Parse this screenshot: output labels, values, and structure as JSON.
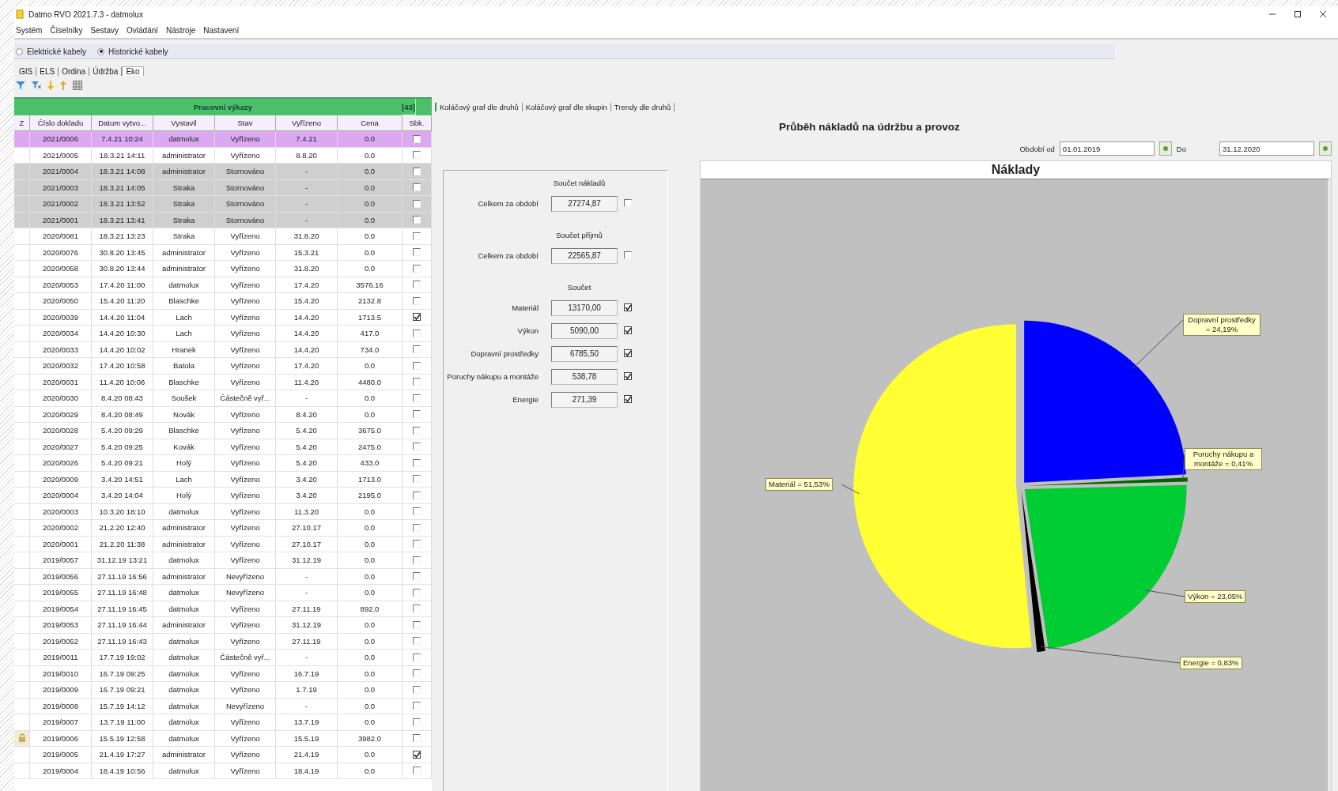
{
  "window": {
    "title": "Datmo RVO 2021.7.3 - datmolux"
  },
  "menu": [
    "Systém",
    "Číselníky",
    "Sestavy",
    "Ovládání",
    "Nástroje",
    "Nastavení"
  ],
  "cable_types": [
    {
      "label": "Elektrické kabely",
      "selected": false
    },
    {
      "label": "Historické kabely",
      "selected": true
    }
  ],
  "modules": [
    {
      "label": "GIS",
      "selected": false
    },
    {
      "label": "ELS",
      "selected": false
    },
    {
      "label": "Ordina",
      "selected": false
    },
    {
      "label": "Údržba",
      "selected": false
    },
    {
      "label": "Eko",
      "selected": true
    }
  ],
  "work_reports": {
    "title": "Pracovní výkazy",
    "count": "[43]",
    "marker_column": "Z",
    "columns": [
      "Číslo dokladu",
      "Datum vytvo...",
      "Vystavil",
      "Stav",
      "Vyřízeno",
      "Cena"
    ],
    "check_column": "Sbk.",
    "rows": [
      {
        "cells": [
          "2021/0006",
          "7.4.21 10:24",
          "datmolux",
          "Vyřízeno",
          "7.4.21",
          "0.0"
        ],
        "selected": true,
        "cancelled": false,
        "locked": false,
        "checked": false
      },
      {
        "cells": [
          "2021/0005",
          "18.3.21 14:11",
          "administrator",
          "Vyřízeno",
          "8.8.20",
          "0.0"
        ],
        "selected": false,
        "cancelled": false,
        "locked": false,
        "checked": false
      },
      {
        "cells": [
          "2021/0004",
          "18.3.21 14:08",
          "administrator",
          "Stornováno",
          "-",
          "0.0"
        ],
        "selected": false,
        "cancelled": true,
        "locked": false,
        "checked": false
      },
      {
        "cells": [
          "2021/0003",
          "18.3.21 14:05",
          "Straka",
          "Stornováno",
          "-",
          "0.0"
        ],
        "selected": false,
        "cancelled": true,
        "locked": false,
        "checked": false
      },
      {
        "cells": [
          "2021/0002",
          "18.3.21 13:52",
          "Straka",
          "Stornováno",
          "-",
          "0.0"
        ],
        "selected": false,
        "cancelled": true,
        "locked": false,
        "checked": false
      },
      {
        "cells": [
          "2021/0001",
          "18.3.21 13:41",
          "Straka",
          "Stornováno",
          "-",
          "0.0"
        ],
        "selected": false,
        "cancelled": true,
        "locked": false,
        "checked": false
      },
      {
        "cells": [
          "2020/0081",
          "18.3.21 13:23",
          "Straka",
          "Vyřízeno",
          "31.8.20",
          "0.0"
        ],
        "selected": false,
        "cancelled": false,
        "locked": false,
        "checked": false
      },
      {
        "cells": [
          "2020/0076",
          "30.8.20 13:45",
          "administrator",
          "Vyřízeno",
          "15.3.21",
          "0.0"
        ],
        "selected": false,
        "cancelled": false,
        "locked": false,
        "checked": false
      },
      {
        "cells": [
          "2020/0058",
          "30.8.20 13:44",
          "administrator",
          "Vyřízeno",
          "31.8.20",
          "0.0"
        ],
        "selected": false,
        "cancelled": false,
        "locked": false,
        "checked": false
      },
      {
        "cells": [
          "2020/0053",
          "17.4.20 11:00",
          "datmolux",
          "Vyřízeno",
          "17.4.20",
          "3576.16"
        ],
        "selected": false,
        "cancelled": false,
        "locked": false,
        "checked": false
      },
      {
        "cells": [
          "2020/0050",
          "15.4.20 11:20",
          "Blaschke",
          "Vyřízeno",
          "15.4.20",
          "2132.8"
        ],
        "selected": false,
        "cancelled": false,
        "locked": false,
        "checked": false
      },
      {
        "cells": [
          "2020/0039",
          "14.4.20 11:04",
          "Lach",
          "Vyřízeno",
          "14.4.20",
          "1713.5"
        ],
        "selected": false,
        "cancelled": false,
        "locked": false,
        "checked": true
      },
      {
        "cells": [
          "2020/0034",
          "14.4.20 10:30",
          "Lach",
          "Vyřízeno",
          "14.4.20",
          "417.0"
        ],
        "selected": false,
        "cancelled": false,
        "locked": false,
        "checked": false
      },
      {
        "cells": [
          "2020/0033",
          "14.4.20 10:02",
          "Hranek",
          "Vyřízeno",
          "14.4.20",
          "734.0"
        ],
        "selected": false,
        "cancelled": false,
        "locked": false,
        "checked": false
      },
      {
        "cells": [
          "2020/0032",
          "17.4.20 10:58",
          "Batola",
          "Vyřízeno",
          "17.4.20",
          "0.0"
        ],
        "selected": false,
        "cancelled": false,
        "locked": false,
        "checked": false
      },
      {
        "cells": [
          "2020/0031",
          "11.4.20 10:06",
          "Blaschke",
          "Vyřízeno",
          "11.4.20",
          "4480.0"
        ],
        "selected": false,
        "cancelled": false,
        "locked": false,
        "checked": false
      },
      {
        "cells": [
          "2020/0030",
          "8.4.20 08:43",
          "Soušek",
          "Částečně vyř...",
          "-",
          "0.0"
        ],
        "selected": false,
        "cancelled": false,
        "locked": false,
        "checked": false
      },
      {
        "cells": [
          "2020/0029",
          "8.4.20 08:49",
          "Novák",
          "Vyřízeno",
          "8.4.20",
          "0.0"
        ],
        "selected": false,
        "cancelled": false,
        "locked": false,
        "checked": false
      },
      {
        "cells": [
          "2020/0028",
          "5.4.20 09:29",
          "Blaschke",
          "Vyřízeno",
          "5.4.20",
          "3675.0"
        ],
        "selected": false,
        "cancelled": false,
        "locked": false,
        "checked": false
      },
      {
        "cells": [
          "2020/0027",
          "5.4.20 09:25",
          "Kovák",
          "Vyřízeno",
          "5.4.20",
          "2475.0"
        ],
        "selected": false,
        "cancelled": false,
        "locked": false,
        "checked": false
      },
      {
        "cells": [
          "2020/0026",
          "5.4.20 09:21",
          "Holý",
          "Vyřízeno",
          "5.4.20",
          "433.0"
        ],
        "selected": false,
        "cancelled": false,
        "locked": false,
        "checked": false
      },
      {
        "cells": [
          "2020/0009",
          "3.4.20 14:51",
          "Lach",
          "Vyřízeno",
          "3.4.20",
          "1713.0"
        ],
        "selected": false,
        "cancelled": false,
        "locked": false,
        "checked": false
      },
      {
        "cells": [
          "2020/0004",
          "3.4.20 14:04",
          "Holý",
          "Vyřízeno",
          "3.4.20",
          "2195.0"
        ],
        "selected": false,
        "cancelled": false,
        "locked": false,
        "checked": false
      },
      {
        "cells": [
          "2020/0003",
          "10.3.20 18:10",
          "datmolux",
          "Vyřízeno",
          "11.3.20",
          "0.0"
        ],
        "selected": false,
        "cancelled": false,
        "locked": false,
        "checked": false
      },
      {
        "cells": [
          "2020/0002",
          "21.2.20 12:40",
          "administrator",
          "Vyřízeno",
          "27.10.17",
          "0.0"
        ],
        "selected": false,
        "cancelled": false,
        "locked": false,
        "checked": false
      },
      {
        "cells": [
          "2020/0001",
          "21.2.20 11:38",
          "administrator",
          "Vyřízeno",
          "27.10.17",
          "0.0"
        ],
        "selected": false,
        "cancelled": false,
        "locked": false,
        "checked": false
      },
      {
        "cells": [
          "2019/0057",
          "31.12.19 13:21",
          "datmolux",
          "Vyřízeno",
          "31.12.19",
          "0.0"
        ],
        "selected": false,
        "cancelled": false,
        "locked": false,
        "checked": false
      },
      {
        "cells": [
          "2019/0056",
          "27.11.19 16:56",
          "administrator",
          "Nevyřízeno",
          "-",
          "0.0"
        ],
        "selected": false,
        "cancelled": false,
        "locked": false,
        "checked": false
      },
      {
        "cells": [
          "2019/0055",
          "27.11.19 16:48",
          "datmolux",
          "Nevyřízeno",
          "-",
          "0.0"
        ],
        "selected": false,
        "cancelled": false,
        "locked": false,
        "checked": false
      },
      {
        "cells": [
          "2019/0054",
          "27.11.19 16:45",
          "datmolux",
          "Vyřízeno",
          "27.11.19",
          "892.0"
        ],
        "selected": false,
        "cancelled": false,
        "locked": false,
        "checked": false
      },
      {
        "cells": [
          "2019/0053",
          "27.11.19 16:44",
          "administrator",
          "Vyřízeno",
          "31.12.19",
          "0.0"
        ],
        "selected": false,
        "cancelled": false,
        "locked": false,
        "checked": false
      },
      {
        "cells": [
          "2019/0052",
          "27.11.19 16:43",
          "datmolux",
          "Vyřízeno",
          "27.11.19",
          "0.0"
        ],
        "selected": false,
        "cancelled": false,
        "locked": false,
        "checked": false
      },
      {
        "cells": [
          "2019/0011",
          "17.7.19 19:02",
          "datmolux",
          "Částečně vyř...",
          "-",
          "0.0"
        ],
        "selected": false,
        "cancelled": false,
        "locked": false,
        "checked": false
      },
      {
        "cells": [
          "2019/0010",
          "16.7.19 09:25",
          "datmolux",
          "Vyřízeno",
          "16.7.19",
          "0.0"
        ],
        "selected": false,
        "cancelled": false,
        "locked": false,
        "checked": false
      },
      {
        "cells": [
          "2019/0009",
          "16.7.19 09:21",
          "datmolux",
          "Vyřízeno",
          "1.7.19",
          "0.0"
        ],
        "selected": false,
        "cancelled": false,
        "locked": false,
        "checked": false
      },
      {
        "cells": [
          "2019/0008",
          "15.7.19 14:12",
          "datmolux",
          "Nevyřízeno",
          "-",
          "0.0"
        ],
        "selected": false,
        "cancelled": false,
        "locked": false,
        "checked": false
      },
      {
        "cells": [
          "2019/0007",
          "13.7.19 11:00",
          "datmolux",
          "Vyřízeno",
          "13.7.19",
          "0.0"
        ],
        "selected": false,
        "cancelled": false,
        "locked": false,
        "checked": false
      },
      {
        "cells": [
          "2019/0006",
          "15.5.19 12:58",
          "datmolux",
          "Vyřízeno",
          "15.5.19",
          "3982.0"
        ],
        "selected": false,
        "cancelled": false,
        "locked": true,
        "checked": false
      },
      {
        "cells": [
          "2019/0005",
          "21.4.19 17:27",
          "administrator",
          "Vyřízeno",
          "21.4.19",
          "0.0"
        ],
        "selected": false,
        "cancelled": false,
        "locked": false,
        "checked": true
      },
      {
        "cells": [
          "2019/0004",
          "18.4.19 10:56",
          "datmolux",
          "Vyřízeno",
          "18.4.19",
          "0.0"
        ],
        "selected": false,
        "cancelled": false,
        "locked": false,
        "checked": false
      }
    ]
  },
  "chart_tabs": [
    {
      "label": "Koláčový graf dle druhů",
      "selected": true
    },
    {
      "label": "Koláčový graf dle skupin",
      "selected": false
    },
    {
      "label": "Trendy dle druhů",
      "selected": false
    }
  ],
  "summary": {
    "groups": [
      {
        "heading": "Součet nákladů",
        "rows": [
          {
            "label": "Celkem za období",
            "value": "27274,87",
            "checked": false
          }
        ]
      },
      {
        "heading": "Součet příjmů",
        "rows": [
          {
            "label": "Celkem za období",
            "value": "22565,87",
            "checked": false
          }
        ]
      },
      {
        "heading": "Součet",
        "rows": [
          {
            "label": "Materiál",
            "value": "13170,00",
            "checked": true
          },
          {
            "label": "Výkon",
            "value": "5090,00",
            "checked": true
          },
          {
            "label": "Dopravní prostředky",
            "value": "6785,50",
            "checked": true
          },
          {
            "label": "Poruchy nákupu a montáže",
            "value": "538,78",
            "checked": true
          },
          {
            "label": "Energie",
            "value": "271,39",
            "checked": true
          }
        ]
      }
    ]
  },
  "chart_panel": {
    "title": "Průběh nákladů na údržbu a provoz",
    "from_label": "Období od",
    "from": "01.01.2019",
    "to_label": "Do",
    "to": "31.12.2020",
    "chart_data": {
      "type": "pie",
      "title": "Náklady",
      "categories": [
        "Dopravní prostředky = 24,19%",
        "Poruchy nákupu a montáže = 0,41%",
        "Výkon = 23,05%",
        "Energie = 0,83%",
        "Materiál = 51,53%"
      ],
      "values": [
        24.19,
        0.41,
        23.05,
        0.83,
        51.53
      ],
      "colors": [
        "#0000ff",
        "#006400",
        "#00cc33",
        "#000000",
        "#ffff33"
      ]
    }
  }
}
